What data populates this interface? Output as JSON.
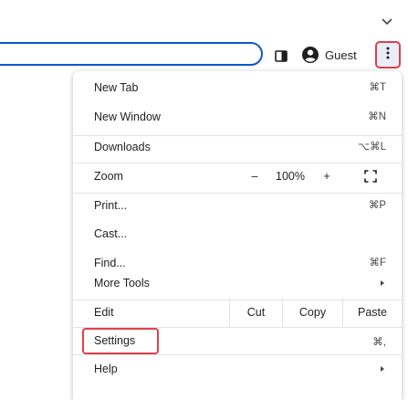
{
  "toolbar": {
    "profile_label": "Guest"
  },
  "menu": {
    "new_tab": {
      "label": "New Tab",
      "shortcut": "⌘T"
    },
    "new_window": {
      "label": "New Window",
      "shortcut": "⌘N"
    },
    "downloads": {
      "label": "Downloads",
      "shortcut": "⌥⌘L"
    },
    "zoom": {
      "label": "Zoom",
      "minus": "–",
      "value": "100%",
      "plus": "+"
    },
    "print": {
      "label": "Print...",
      "shortcut": "⌘P"
    },
    "cast": {
      "label": "Cast..."
    },
    "find": {
      "label": "Find...",
      "shortcut": "⌘F"
    },
    "more_tools": {
      "label": "More Tools"
    },
    "edit": {
      "label": "Edit",
      "cut": "Cut",
      "copy": "Copy",
      "paste": "Paste"
    },
    "settings": {
      "label": "Settings",
      "shortcut": "⌘,"
    },
    "help": {
      "label": "Help"
    }
  },
  "colors": {
    "accent": "#0b57d0",
    "highlight": "#e0404a",
    "menu_button_bg": "#e9eef6"
  },
  "icons": {
    "tab_strip": "chevron-down-icon",
    "side_panel": "side-panel-icon",
    "profile": "account-circle-icon",
    "menu": "three-dots-vertical-icon",
    "fullscreen": "fullscreen-icon",
    "submenu": "chevron-right-icon"
  }
}
